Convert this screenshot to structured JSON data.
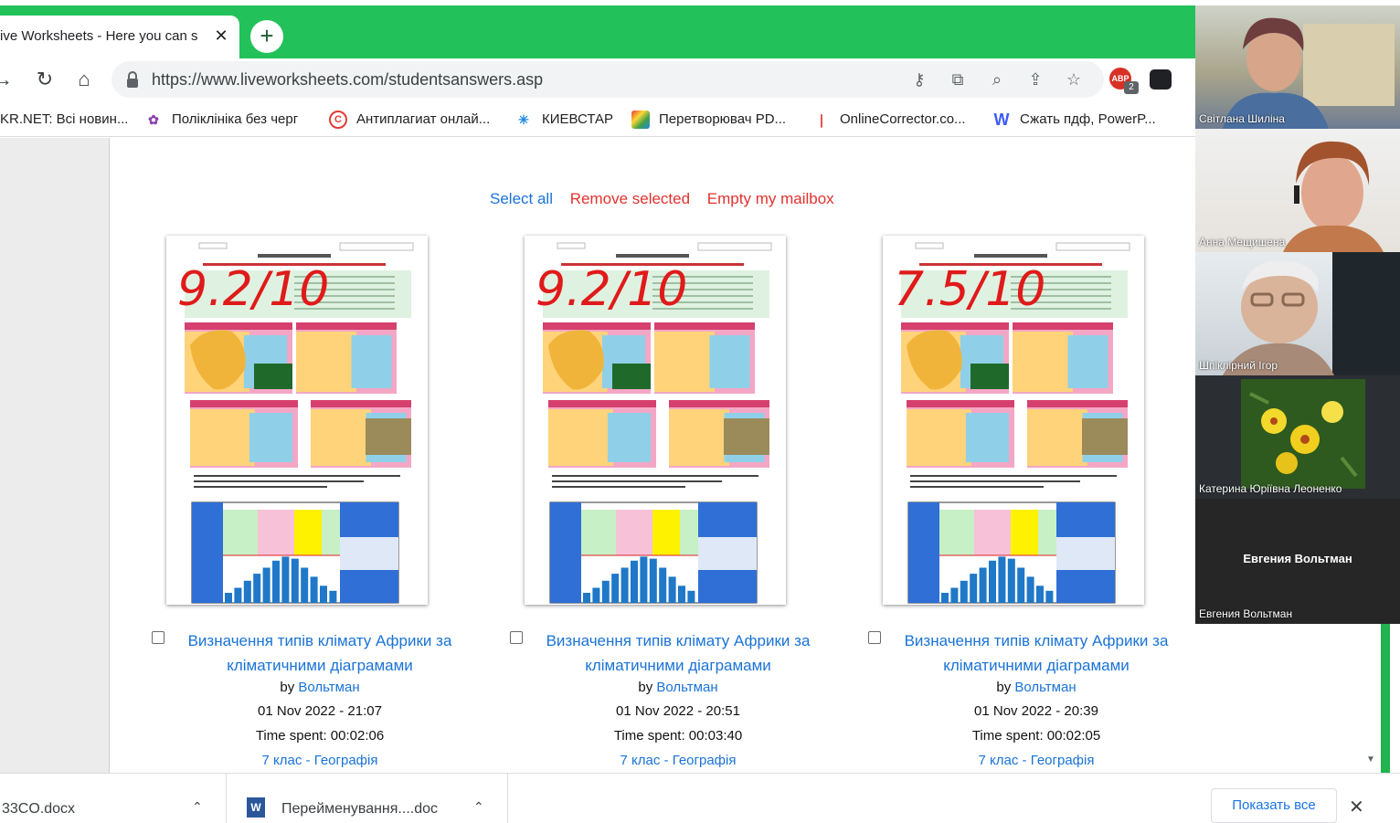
{
  "browser": {
    "tab_title": "ive Worksheets - Here you can s",
    "tab_close": "✕",
    "new_tab": "+",
    "url": "https://www.liveworksheets.com/studentsanswers.asp",
    "ext_abp": "ABP",
    "ext_badge": "2",
    "accent": "#23c15a"
  },
  "bookmarks": [
    {
      "label": "KR.NET: Всі новин...",
      "icon": "ukr-net-icon"
    },
    {
      "label": "Поліклініка без черг",
      "icon": "flower-icon"
    },
    {
      "label": "Антиплагиат онлай...",
      "icon": "copyright-icon"
    },
    {
      "label": "КИЕВСТАР",
      "icon": "star-icon"
    },
    {
      "label": "Перетворювач PD...",
      "icon": "colorful-squares-icon"
    },
    {
      "label": "OnlineCorrector.co...",
      "icon": "pen-icon"
    },
    {
      "label": "Сжать пдф, PowerP...",
      "icon": "w-icon"
    }
  ],
  "actions": {
    "select_all": "Select all",
    "remove_selected": "Remove selected",
    "empty_mailbox": "Empty my mailbox"
  },
  "cards": [
    {
      "score": "9.2/10",
      "title_line1": "Визначення типів клімату Африки за",
      "title_line2": "кліматичними діаграмами",
      "by_label": "by",
      "author": "Вольтман",
      "datetime": "01 Nov 2022 - 21:07",
      "time_spent": "Time spent: 00:02:06",
      "grade": "7 клас",
      "separator": "-",
      "subject": "Географія"
    },
    {
      "score": "9.2/10",
      "title_line1": "Визначення типів клімату Африки за",
      "title_line2": "кліматичними діаграмами",
      "by_label": "by",
      "author": "Вольтман",
      "datetime": "01 Nov 2022 - 20:51",
      "time_spent": "Time spent: 00:03:40",
      "grade": "7 клас",
      "separator": "-",
      "subject": "Географія"
    },
    {
      "score": "7.5/10",
      "title_line1": "Визначення типів клімату Африки за",
      "title_line2": "кліматичними діаграмами",
      "by_label": "by",
      "author": "Вольтман",
      "datetime": "01 Nov 2022 - 20:39",
      "time_spent": "Time spent: 00:02:05",
      "grade": "7 клас",
      "separator": "-",
      "subject": "Географія"
    }
  ],
  "downloads": {
    "items": [
      {
        "name": "33CO.docx"
      },
      {
        "name": "Перейменування....doc"
      }
    ],
    "show_all": "Показать все",
    "close": "✕"
  },
  "participants": [
    {
      "name": "Світлана Шиліна"
    },
    {
      "name": "Анна Мещишена"
    },
    {
      "name": "Шпіклірний Ігор"
    },
    {
      "name": "Катерина Юріївна Леоненко"
    },
    {
      "name": "Евгения Вольтман",
      "center_label": "Евгения Вольтман"
    }
  ]
}
